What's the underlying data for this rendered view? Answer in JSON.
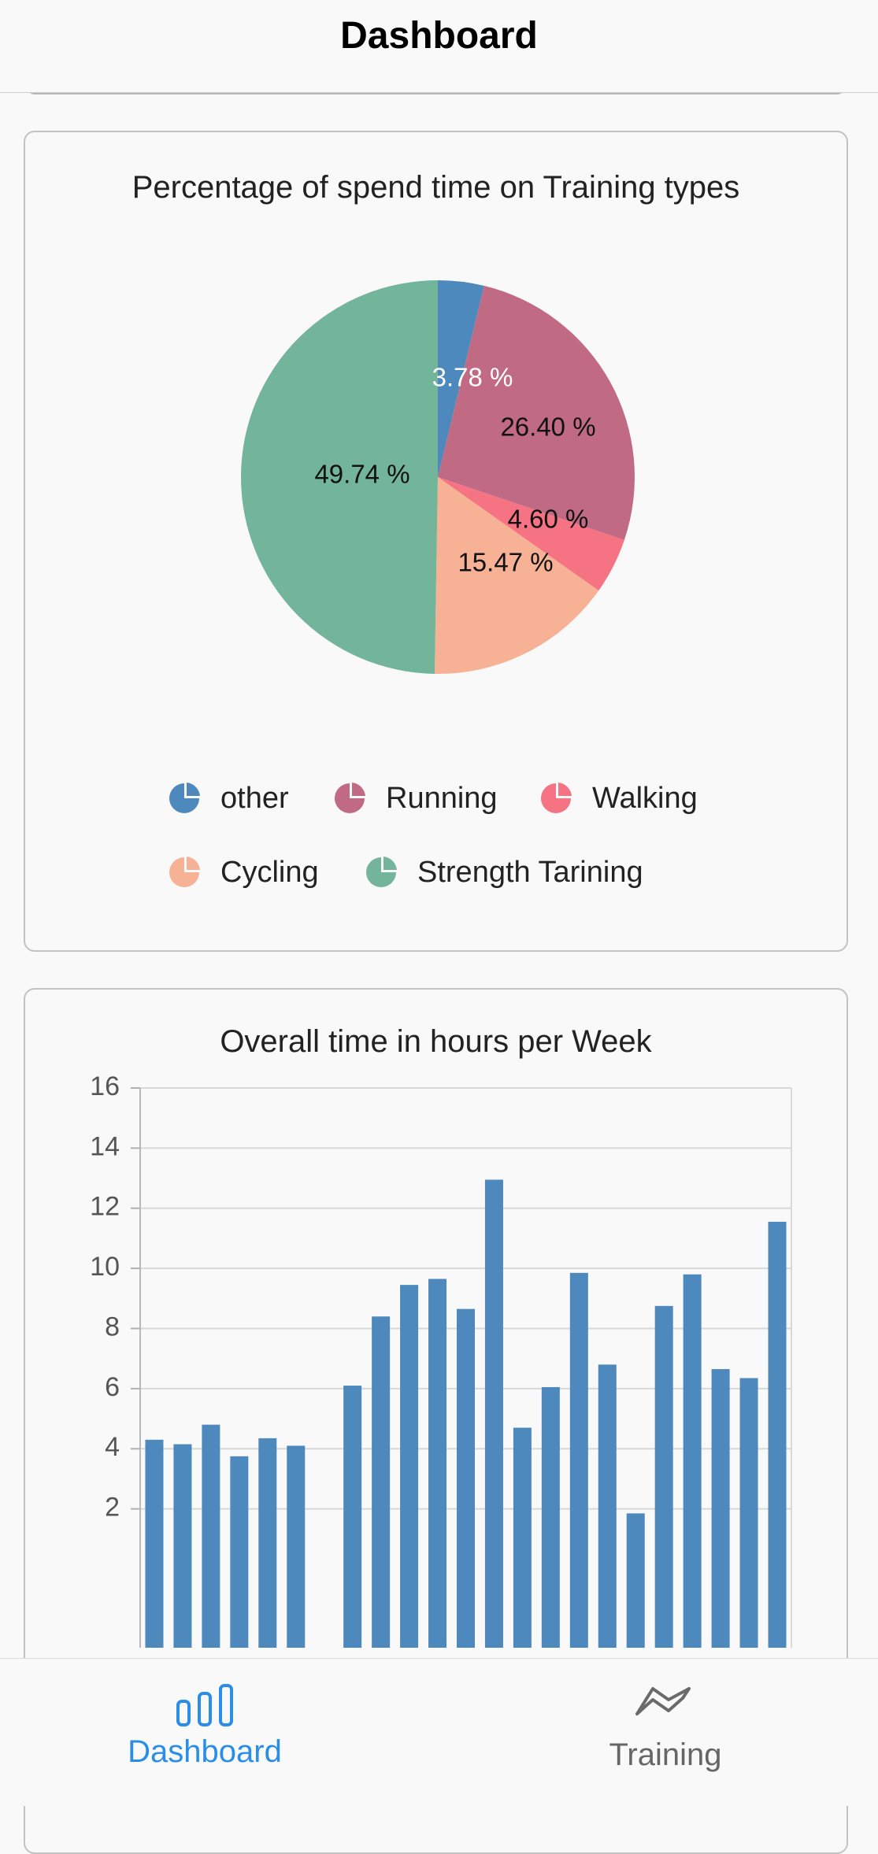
{
  "header": {
    "title": "Dashboard"
  },
  "pie_card": {
    "title": "Percentage of spend time on Training types",
    "legend": [
      {
        "label": "other",
        "color": "#4e89bd",
        "icon": "pie-legend-icon"
      },
      {
        "label": "Running",
        "color": "#c06b83",
        "icon": "pie-legend-icon"
      },
      {
        "label": "Walking",
        "color": "#f57383",
        "icon": "pie-legend-icon"
      },
      {
        "label": "Cycling",
        "color": "#f7b195",
        "icon": "pie-legend-icon"
      },
      {
        "label": "Strength Tarining",
        "color": "#73b59a",
        "icon": "pie-legend-icon"
      }
    ]
  },
  "bar_card": {
    "title": "Overall time in hours per Week"
  },
  "chart_data": [
    {
      "type": "pie",
      "title": "Percentage of spend time on Training types",
      "slices": [
        {
          "label": "other",
          "value": 3.78,
          "display": "3.78 %",
          "color": "#4e89bd",
          "label_color": "#ffffff"
        },
        {
          "label": "Running",
          "value": 26.4,
          "display": "26.40 %",
          "color": "#c06b83",
          "label_color": "#111111"
        },
        {
          "label": "Walking",
          "value": 4.6,
          "display": "4.60 %",
          "color": "#f57383",
          "label_color": "#111111"
        },
        {
          "label": "Cycling",
          "value": 15.47,
          "display": "15.47 %",
          "color": "#f7b195",
          "label_color": "#111111"
        },
        {
          "label": "Strength Tarining",
          "value": 49.74,
          "display": "49.74 %",
          "color": "#73b59a",
          "label_color": "#111111"
        }
      ],
      "legend_position": "bottom"
    },
    {
      "type": "bar",
      "title": "Overall time in hours per Week",
      "ylim": [
        0,
        16
      ],
      "y_ticks": [
        2,
        4,
        6,
        8,
        10,
        12,
        14,
        16
      ],
      "grid": true,
      "color": "#4e89bd",
      "values": [
        4.3,
        4.15,
        4.8,
        3.75,
        4.35,
        4.1,
        0,
        6.1,
        8.4,
        9.45,
        9.65,
        8.65,
        12.95,
        4.7,
        6.05,
        9.85,
        6.8,
        1.85,
        8.75,
        9.8,
        6.65,
        6.35,
        11.55
      ]
    }
  ],
  "bottom_nav": {
    "items": [
      {
        "label": "Dashboard",
        "icon": "bar-chart-icon",
        "active": true,
        "color": "#2a8ee8"
      },
      {
        "label": "Training",
        "icon": "trend-line-icon",
        "active": false,
        "color": "#666666"
      }
    ]
  }
}
